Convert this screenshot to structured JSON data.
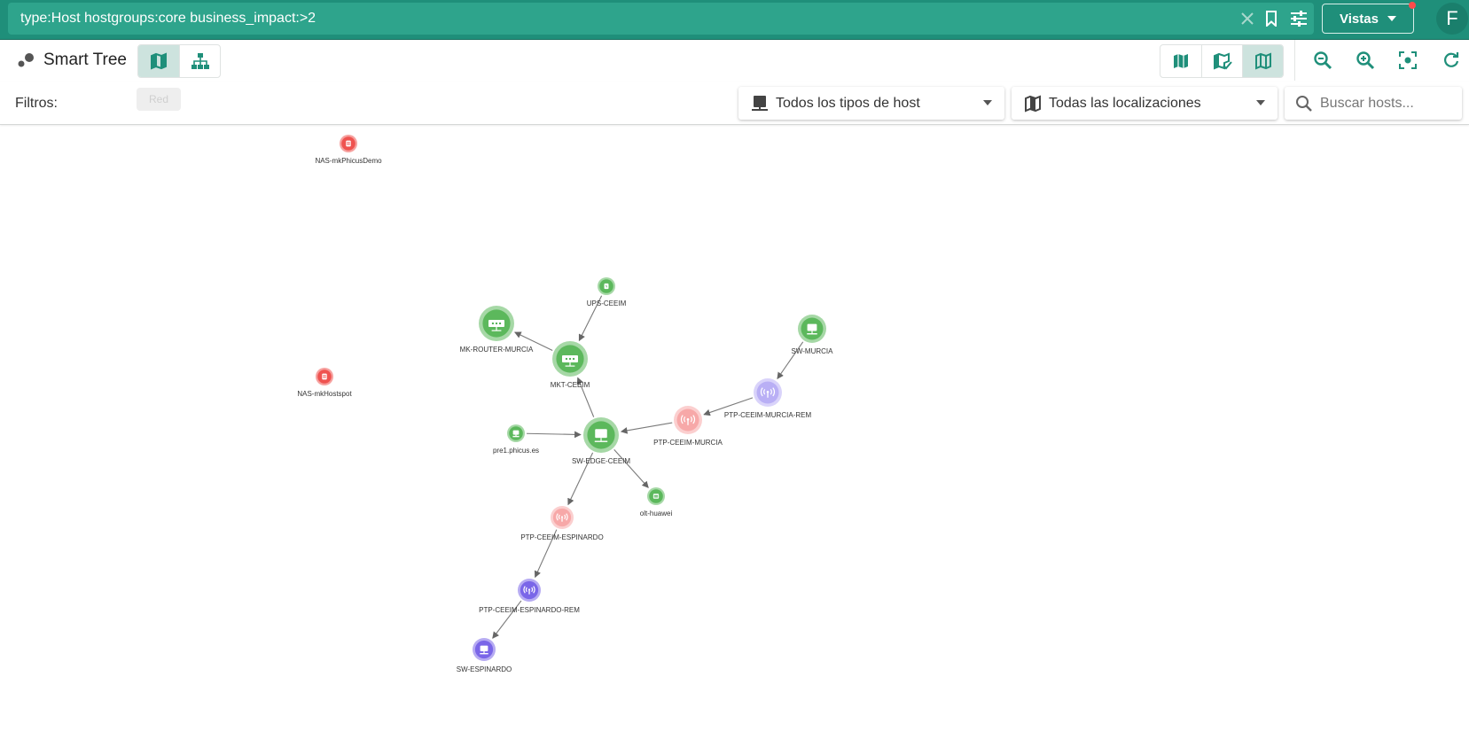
{
  "topbar": {
    "query": "type:Host hostgroups:core business_impact:>2",
    "vistas_label": "Vistas",
    "avatar_letter": "F",
    "color": "#1f8f7a"
  },
  "toolbar": {
    "title": "Smart Tree",
    "view_toggle": [
      "map",
      "hierarchy"
    ],
    "map_modes": [
      "map",
      "map-check",
      "map-outline"
    ],
    "actions": [
      "zoom-out",
      "zoom-in",
      "fit",
      "refresh"
    ]
  },
  "filters": {
    "label": "Filtros:",
    "chip": "Red",
    "host_type": "Todos los tipos de host",
    "location": "Todas las localizaciones",
    "search_placeholder": "Buscar hosts..."
  },
  "graph": {
    "colors": {
      "ok": "#5cb85c",
      "critical": "#ef5350",
      "critical_soft": "#f7a8a8",
      "warning_soft": "#b9aff5",
      "purple": "#7a66e8"
    },
    "nodes": [
      {
        "id": "NAS-mkPhicusDemo",
        "label": "NAS-mkPhicusDemo",
        "status": "critical",
        "icon": "storage"
      },
      {
        "id": "UPS-CEEIM",
        "label": "UPS-CEEIM",
        "status": "ok",
        "icon": "ups"
      },
      {
        "id": "MK-ROUTER-MURCIA",
        "label": "MK-ROUTER-MURCIA",
        "status": "ok",
        "icon": "router"
      },
      {
        "id": "MKT-CEEIM",
        "label": "MKT-CEEIM",
        "status": "ok",
        "icon": "router"
      },
      {
        "id": "SW-MURCIA",
        "label": "SW-MURCIA",
        "status": "ok",
        "icon": "switch"
      },
      {
        "id": "PTP-CEEIM-MURCIA-REM",
        "label": "PTP-CEEIM-MURCIA-REM",
        "status": "warning_soft",
        "icon": "antenna"
      },
      {
        "id": "NAS-mkHostspot",
        "label": "NAS-mkHostspot",
        "status": "critical",
        "icon": "storage"
      },
      {
        "id": "PTP-CEEIM-MURCIA",
        "label": "PTP-CEEIM-MURCIA",
        "status": "critical_soft",
        "icon": "antenna"
      },
      {
        "id": "pre1.phicus.es",
        "label": "pre1.phicus.es",
        "status": "ok",
        "icon": "server"
      },
      {
        "id": "SW-EDGE-CEEIM",
        "label": "SW-EDGE-CEEIM",
        "status": "ok",
        "icon": "switch"
      },
      {
        "id": "olt-huawei",
        "label": "olt-huawei",
        "status": "ok",
        "icon": "olt"
      },
      {
        "id": "PTP-CEEIM-ESPINARDO",
        "label": "PTP-CEEIM-ESPINARDO",
        "status": "critical_soft",
        "icon": "antenna"
      },
      {
        "id": "PTP-CEEIM-ESPINARDO-REM",
        "label": "PTP-CEEIM-ESPINARDO-REM",
        "status": "purple",
        "icon": "antenna"
      },
      {
        "id": "SW-ESPINARDO",
        "label": "SW-ESPINARDO",
        "status": "purple",
        "icon": "switch"
      }
    ],
    "edges": [
      [
        "UPS-CEEIM",
        "MKT-CEEIM"
      ],
      [
        "MKT-CEEIM",
        "MK-ROUTER-MURCIA"
      ],
      [
        "SW-EDGE-CEEIM",
        "MKT-CEEIM"
      ],
      [
        "SW-MURCIA",
        "PTP-CEEIM-MURCIA-REM"
      ],
      [
        "PTP-CEEIM-MURCIA-REM",
        "PTP-CEEIM-MURCIA"
      ],
      [
        "PTP-CEEIM-MURCIA",
        "SW-EDGE-CEEIM"
      ],
      [
        "pre1.phicus.es",
        "SW-EDGE-CEEIM"
      ],
      [
        "SW-EDGE-CEEIM",
        "olt-huawei"
      ],
      [
        "SW-EDGE-CEEIM",
        "PTP-CEEIM-ESPINARDO"
      ],
      [
        "PTP-CEEIM-ESPINARDO",
        "PTP-CEEIM-ESPINARDO-REM"
      ],
      [
        "PTP-CEEIM-ESPINARDO-REM",
        "SW-ESPINARDO"
      ]
    ]
  }
}
